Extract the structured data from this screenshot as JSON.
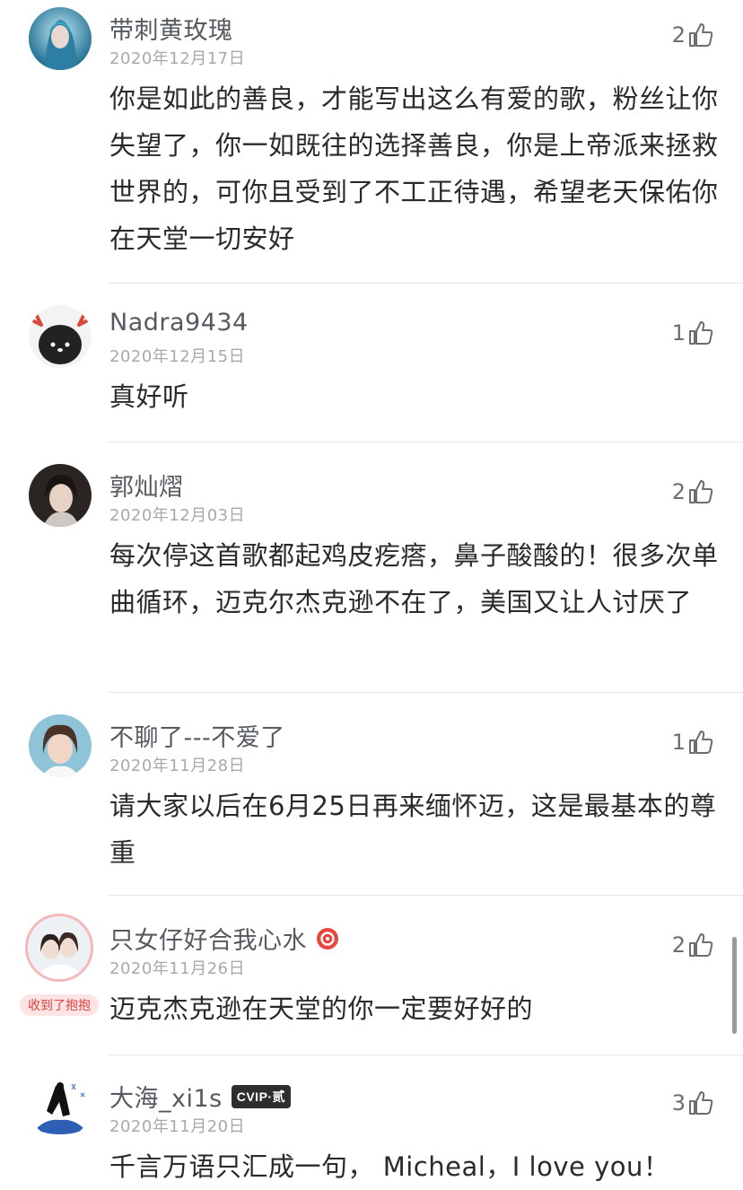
{
  "comments": [
    {
      "username": "带刺黄玫瑰",
      "date": "2020年12月17日",
      "likes": "2",
      "text": "你是如此的善良，才能写出这么有爱的歌，粉丝让你失望了，你一如既往的选择善良，你是上帝派来拯救世界的，可你且受到了不工正待遇，希望老天保佑你在天堂一切安好",
      "avatar": "avatar-blue-girl"
    },
    {
      "username": "Nadra9434",
      "date": "2020年12月15日",
      "likes": "1",
      "text": "真好听",
      "avatar": "avatar-black-moose"
    },
    {
      "username": "郭灿熠",
      "date": "2020年12月03日",
      "likes": "2",
      "text": "每次停这首歌都起鸡皮疙瘩，鼻子酸酸的！很多次单曲循环，迈克尔杰克逊不在了，美国又让人讨厌了",
      "avatar": "avatar-girl-dark"
    },
    {
      "username": "不聊了---不爱了",
      "date": "2020年11月28日",
      "likes": "1",
      "text": "请大家以后在6月25日再来缅怀迈，这是最基本的尊重",
      "avatar": "avatar-girl-blue-bg"
    },
    {
      "username": "只女仔好合我心水",
      "date": "2020年11月26日",
      "likes": "2",
      "text": "迈克杰克逊在天堂的你一定要好好的",
      "avatar": "avatar-two-girls",
      "tag": "收到了抱抱",
      "badge": "vip-red-badge"
    },
    {
      "username": "大海_xi1s",
      "date": "2020年11月20日",
      "likes": "3",
      "text": "千言万语只汇成一句， Micheal，I love you！",
      "avatar": "avatar-winter",
      "badge_text": "CVIP·贰"
    }
  ],
  "colors": {
    "username": "#555a60",
    "date": "#a6a9ad",
    "body": "#2a2a2a",
    "accent_red": "#e0413f",
    "divider": "#e6e6e6"
  }
}
